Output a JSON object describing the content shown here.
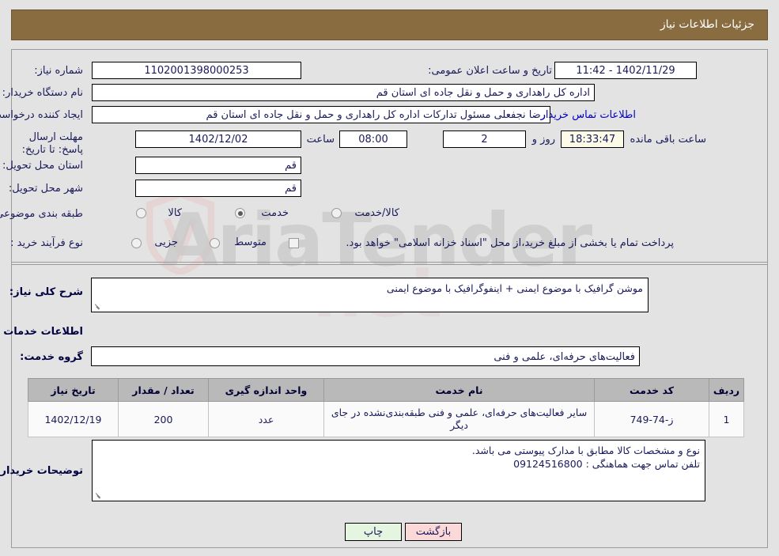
{
  "header": {
    "title": "جزئیات اطلاعات نیاز"
  },
  "form": {
    "need_number_label": "شماره نیاز:",
    "need_number_value": "1102001398000253",
    "announce_datetime_label": "تاریخ و ساعت اعلان عمومی:",
    "announce_datetime_value": "1402/11/29 - 11:42",
    "buyer_org_label": "نام دستگاه خریدار:",
    "buyer_org_value": "اداره کل راهداری و حمل و نقل جاده ای استان قم",
    "creator_label": "ایجاد کننده درخواست:",
    "creator_value": "رضا  نجفعلی مسئول تدارکات اداره کل راهداری و حمل و نقل جاده ای استان قم",
    "buyer_contact_link": "اطلاعات تماس خریدار",
    "deadline_label": "مهلت ارسال پاسخ: تا تاریخ:",
    "deadline_date": "1402/12/02",
    "deadline_hour_label": "ساعت",
    "deadline_hour_value": "08:00",
    "days_value": "2",
    "days_suffix_label": "روز و",
    "remaining_time_value": "18:33:47",
    "remaining_time_suffix": "ساعت باقی مانده",
    "province_label": "استان محل تحویل:",
    "province_value": "قم",
    "city_label": "شهر محل تحویل:",
    "city_value": "قم",
    "category_label": "طبقه بندی موضوعی:",
    "category_options": [
      {
        "label": "کالا",
        "selected": false
      },
      {
        "label": "خدمت",
        "selected": true
      },
      {
        "label": "کالا/خدمت",
        "selected": false
      }
    ],
    "purchase_type_label": "نوع فرآیند خرید :",
    "purchase_type_options": [
      {
        "label": "جزیی",
        "selected": false
      },
      {
        "label": "متوسط",
        "selected": false
      }
    ],
    "treasury_checkbox_label": "پرداخت تمام یا بخشی از مبلغ خرید،از محل \"اسناد خزانه اسلامی\" خواهد بود.",
    "treasury_checkbox_checked": false
  },
  "description": {
    "need_summary_label": "شرح کلی نیاز:",
    "need_summary_value": "موشن گرافیک با موضوع ایمنی + اینفوگرافیک با موضوع ایمنی",
    "services_section_title": "اطلاعات خدمات مورد نیاز",
    "service_group_label": "گروه خدمت:",
    "service_group_value": "فعالیت‌های حرفه‌ای، علمی و فنی"
  },
  "table": {
    "columns": [
      "ردیف",
      "کد خدمت",
      "نام خدمت",
      "واحد اندازه گیری",
      "تعداد / مقدار",
      "تاریخ نیاز"
    ],
    "rows": [
      {
        "row": "1",
        "code": "ز-74-749",
        "name": "سایر فعالیت‌های حرفه‌ای، علمی و فنی طبقه‌بندی‌نشده در جای دیگر",
        "unit": "عدد",
        "quantity": "200",
        "need_date": "1402/12/19"
      }
    ]
  },
  "notes": {
    "label": "توضیحات خریدار:",
    "line1": "نوع و مشخصات کالا مطابق با مدارک پیوستی می باشد.",
    "line2": "تلفن تماس جهت هماهنگی : 09124516800"
  },
  "footer": {
    "print_label": "چاپ",
    "back_label": "بازگشت"
  },
  "watermark": {
    "text": "AriaTender",
    "text2": "net"
  },
  "colors": {
    "header_bg": "#8a6c41",
    "link": "#0000c8",
    "text": "#1a1a5a",
    "table_header_bg": "#b9b9b9",
    "print_btn": "#e4f6e0",
    "back_btn": "#fbd9d9",
    "highlight_field": "#fbfbe8"
  }
}
